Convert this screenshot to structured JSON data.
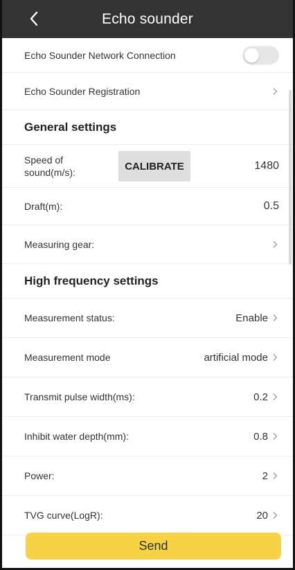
{
  "header": {
    "title": "Echo sounder"
  },
  "network": {
    "label": "Echo Sounder Network Connection",
    "enabled": false
  },
  "registration": {
    "label": "Echo Sounder Registration"
  },
  "general": {
    "title": "General settings",
    "speed_of_sound": {
      "label": "Speed of sound(m/s):",
      "button": "CALIBRATE",
      "value": "1480"
    },
    "draft": {
      "label": "Draft(m):",
      "value": "0.5"
    },
    "measuring_gear": {
      "label": "Measuring gear:"
    }
  },
  "high_frequency": {
    "title": "High frequency settings",
    "items": [
      {
        "label": "Measurement status:",
        "value": "Enable"
      },
      {
        "label": "Measurement mode",
        "value": "artificial mode"
      },
      {
        "label": "Transmit pulse width(ms):",
        "value": "0.2"
      },
      {
        "label": "Inhibit water depth(mm):",
        "value": "0.8"
      },
      {
        "label": "Power:",
        "value": "2"
      },
      {
        "label": "TVG curve(LogR):",
        "value": "20"
      }
    ]
  },
  "actions": {
    "send": "Send"
  },
  "colors": {
    "header": "#333333",
    "send_button": "#f7d245",
    "toggle_off": "#e6e6e6"
  }
}
